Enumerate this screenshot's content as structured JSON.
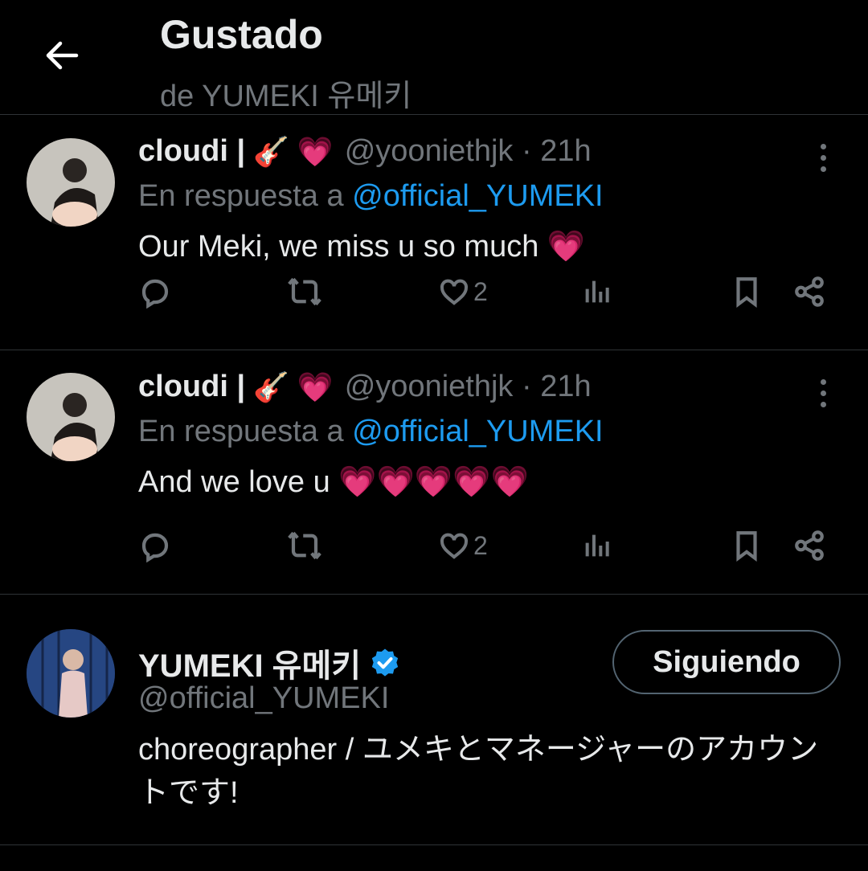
{
  "header": {
    "title": "Gustado",
    "subtitle": "de YUMEKI 유메키"
  },
  "tweets": [
    {
      "name": "cloudi | ",
      "emojis": "🎸 💗",
      "handle": "@yooniethjk · 21h",
      "reply_prefix": "En respuesta a ",
      "reply_mention": "@official_YUMEKI",
      "text": "Our Meki, we miss u so much 💗",
      "likes": "2"
    },
    {
      "name": "cloudi | ",
      "emojis": "🎸 💗",
      "handle": "@yooniethjk · 21h",
      "reply_prefix": "En respuesta a ",
      "reply_mention": "@official_YUMEKI",
      "text": "And we love u 💗💗💗💗💗",
      "likes": "2"
    }
  ],
  "profile": {
    "name": "YUMEKI 유메키",
    "handle": "@official_YUMEKI",
    "follow_label": "Siguiendo",
    "bio": "choreographer /  ユメキとマネージャーのアカウントです!"
  },
  "colors": {
    "background": "#000000",
    "text": "#e7e9ea",
    "muted": "#71767b",
    "mention": "#1d9bf0",
    "divider": "#2f3336",
    "verified": "#1d9bf0"
  },
  "icons": [
    "back-arrow-icon",
    "more-icon",
    "reply-icon",
    "retweet-icon",
    "like-icon",
    "views-icon",
    "bookmark-icon",
    "share-icon",
    "verified-badge-icon"
  ]
}
